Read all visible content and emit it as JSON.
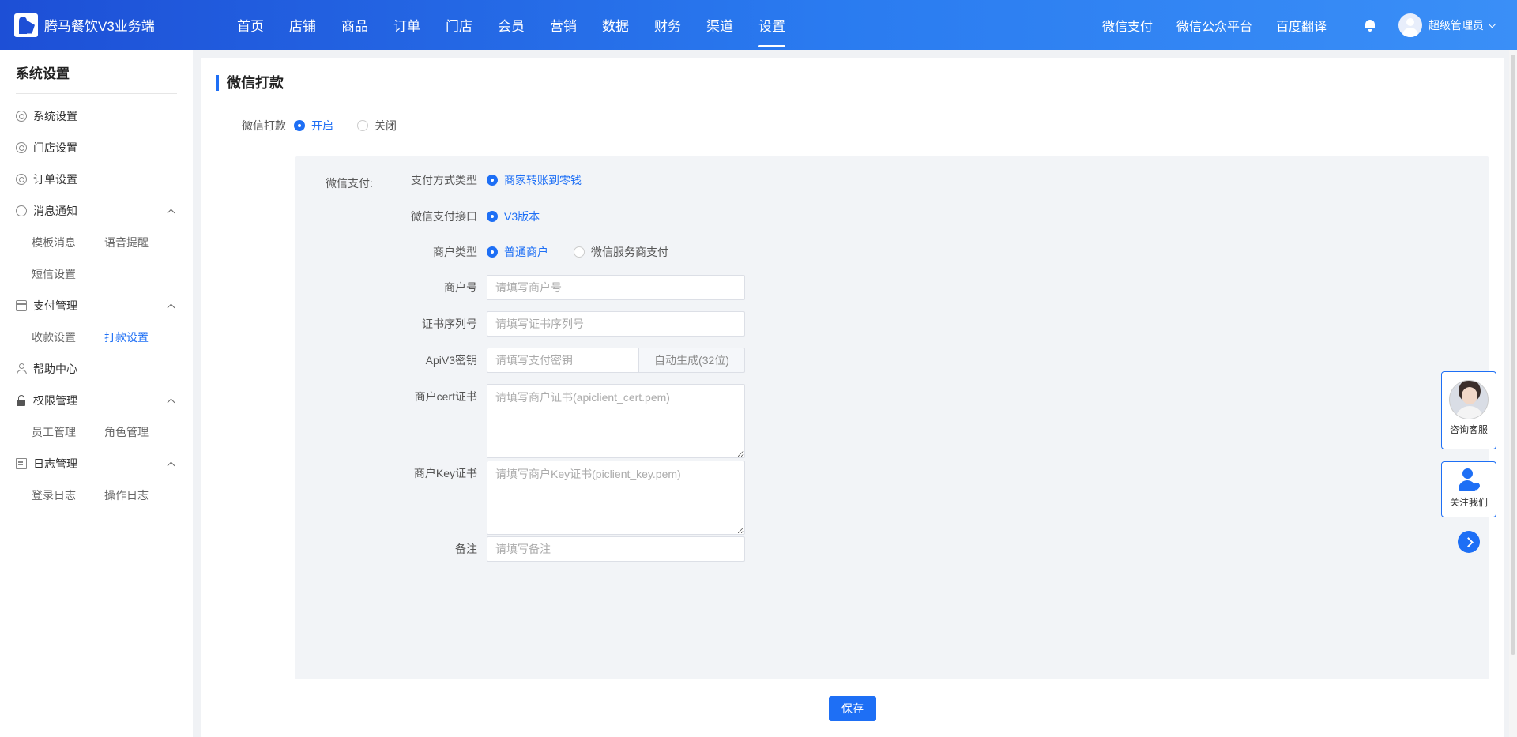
{
  "header": {
    "app_title": "腾马餐饮V3业务端",
    "nav": [
      "首页",
      "店铺",
      "商品",
      "订单",
      "门店",
      "会员",
      "营销",
      "数据",
      "财务",
      "渠道",
      "设置"
    ],
    "active_nav": "设置",
    "links": [
      "微信支付",
      "微信公众平台",
      "百度翻译"
    ],
    "user_name": "超级管理员",
    "bell_icon": "bell-icon"
  },
  "sidebar": {
    "title": "系统设置",
    "items": {
      "system": "系统设置",
      "store": "门店设置",
      "order": "订单设置",
      "message": "消息通知",
      "message_subs": [
        "模板消息",
        "语音提醒",
        "短信设置"
      ],
      "payment": "支付管理",
      "payment_subs": [
        "收款设置",
        "打款设置"
      ],
      "help": "帮助中心",
      "permission": "权限管理",
      "permission_subs": [
        "员工管理",
        "角色管理"
      ],
      "log": "日志管理",
      "log_subs": [
        "登录日志",
        "操作日志"
      ]
    },
    "active_sub": "打款设置"
  },
  "main": {
    "title": "微信打款",
    "toggle": {
      "label": "微信打款",
      "on": "开启",
      "off": "关闭",
      "selected": "开启"
    },
    "panel": {
      "title": "微信支付:",
      "pay_type": {
        "label": "支付方式类型",
        "option": "商家转账到零钱"
      },
      "api": {
        "label": "微信支付接口",
        "option": "V3版本"
      },
      "merchant_type": {
        "label": "商户类型",
        "options": [
          "普通商户",
          "微信服务商支付"
        ],
        "selected": "普通商户"
      },
      "merchant_no": {
        "label": "商户号",
        "placeholder": "请填写商户号"
      },
      "cert_serial": {
        "label": "证书序列号",
        "placeholder": "请填写证书序列号"
      },
      "apiv3_key": {
        "label": "ApiV3密钥",
        "placeholder": "请填写支付密钥",
        "suffix": "自动生成(32位)"
      },
      "cert": {
        "label": "商户cert证书",
        "placeholder": "请填写商户证书(apiclient_cert.pem)"
      },
      "key_cert": {
        "label": "商户Key证书",
        "placeholder": "请填写商户Key证书(piclient_key.pem)"
      },
      "remark": {
        "label": "备注",
        "placeholder": "请填写备注"
      }
    },
    "save_label": "保存"
  },
  "float": {
    "consult": "咨询客服",
    "follow": "关注我们"
  },
  "colors": {
    "primary": "#1e6ff5",
    "header_start": "#1d4fd6",
    "header_end": "#3a8ff7"
  }
}
